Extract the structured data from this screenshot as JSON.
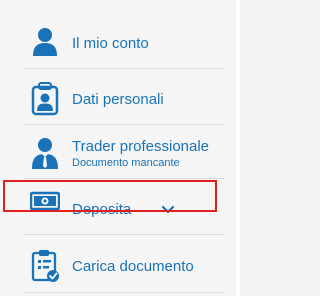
{
  "menu": {
    "items": [
      {
        "label": "Il mio conto",
        "icon": "user-icon"
      },
      {
        "label": "Dati personali",
        "icon": "id-badge-icon"
      },
      {
        "label": "Trader professionale",
        "sublabel": "Documento mancante",
        "icon": "professional-user-icon"
      },
      {
        "label": "Deposita",
        "icon": "banknote-icon",
        "expand_icon": "chevron-down-icon"
      },
      {
        "label": "Carica documento",
        "icon": "clipboard-check-icon"
      }
    ]
  },
  "colors": {
    "accent": "#1a73b8",
    "background": "#f5f5f5",
    "divider": "#d9d9d9",
    "highlight": "#e02020"
  }
}
